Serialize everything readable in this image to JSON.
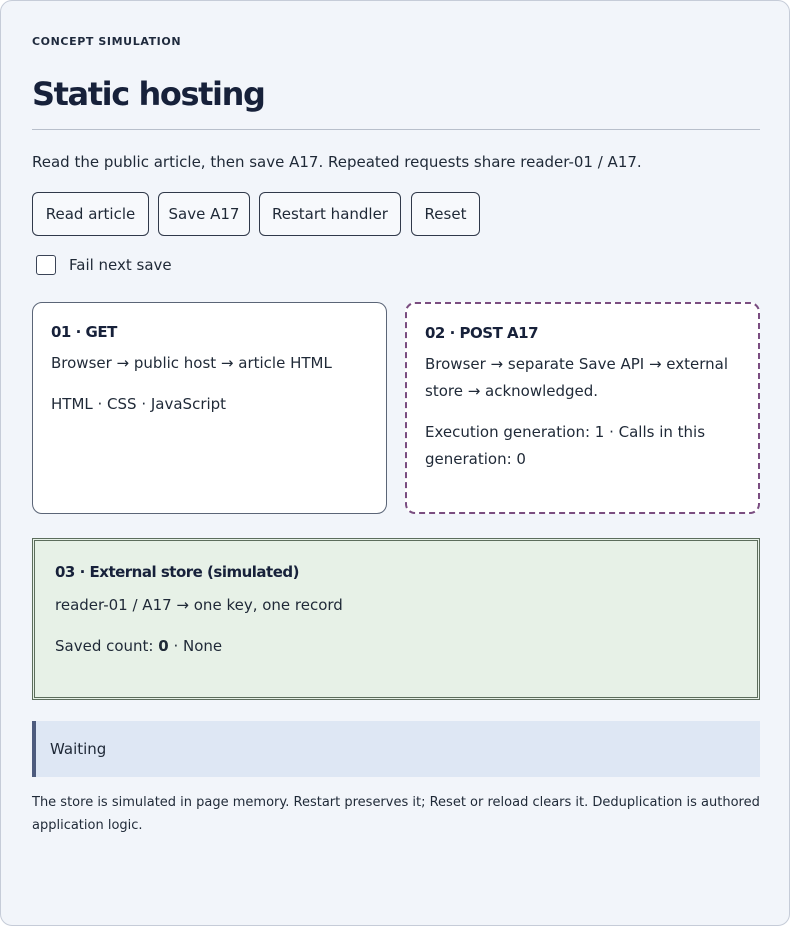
{
  "eyebrow": "CONCEPT SIMULATION",
  "title": "Static hosting",
  "intro": "Read the public article, then save A17. Repeated requests share reader-01 / A17.",
  "buttons": {
    "read": "Read article",
    "save": "Save A17",
    "restart": "Restart handler",
    "reset": "Reset"
  },
  "checkbox": {
    "label": "Fail next save",
    "checked": false
  },
  "step1": {
    "heading": "01 · GET",
    "line1": "Browser → public host → article HTML",
    "line2": "HTML · CSS · JavaScript"
  },
  "step2": {
    "heading": "02 · POST A17",
    "line1": "Browser → separate Save API → external store → acknowledged.",
    "line2": "Execution generation: 1 · Calls in this generation: 0"
  },
  "step3": {
    "heading": "03 · External store (simulated)",
    "line1": "reader-01 / A17 → one key, one record",
    "saved_prefix": "Saved count: ",
    "saved_count": "0",
    "saved_suffix": " · None"
  },
  "status": "Waiting",
  "footnote": "The store is simulated in page memory. Restart preserves it; Reset or reload clears it. Deduplication is authored application logic.",
  "colors": {
    "panel_bg": "#f2f5fa",
    "store_bg": "#e7f1e7",
    "status_bg": "#dee7f4",
    "active_border": "#7a4d80"
  }
}
